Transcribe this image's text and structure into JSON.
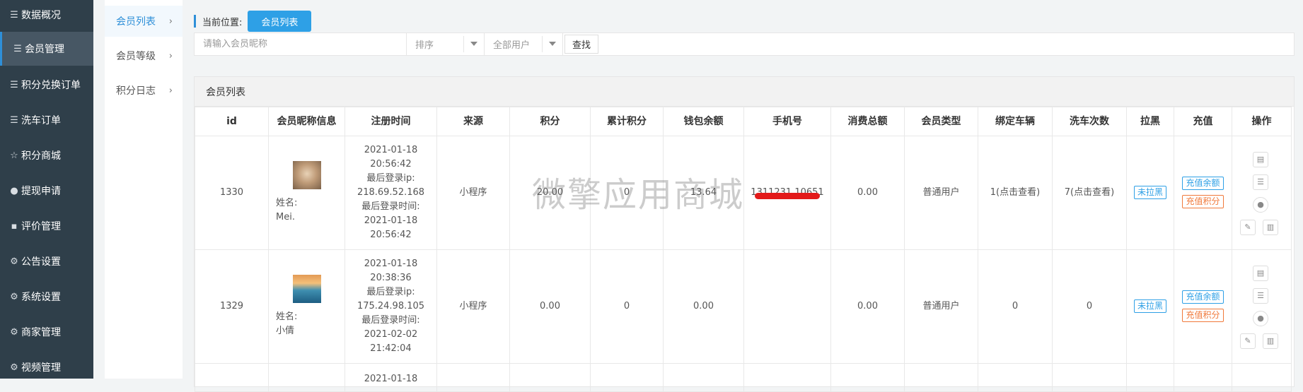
{
  "sidebar": {
    "items": [
      {
        "label": "数据概况",
        "icon": "list-icon"
      },
      {
        "label": "会员管理",
        "icon": "list-icon"
      },
      {
        "label": "积分兑换订单",
        "icon": "list-icon"
      },
      {
        "label": "洗车订单",
        "icon": "list-icon"
      },
      {
        "label": "积分商城",
        "icon": "star-icon"
      },
      {
        "label": "提现申请",
        "icon": "users-icon"
      },
      {
        "label": "评价管理",
        "icon": "comment-icon"
      },
      {
        "label": "公告设置",
        "icon": "gear-icon"
      },
      {
        "label": "系统设置",
        "icon": "gear-icon"
      },
      {
        "label": "商家管理",
        "icon": "gear-icon"
      },
      {
        "label": "视频管理",
        "icon": "gear-icon"
      }
    ]
  },
  "submenu": {
    "items": [
      {
        "label": "会员列表"
      },
      {
        "label": "会员等级"
      },
      {
        "label": "积分日志"
      }
    ]
  },
  "breadcrumb": {
    "label": "当前位置:",
    "current": "会员列表"
  },
  "filters": {
    "search_placeholder": "请输入会员昵称",
    "sort_label": "排序",
    "user_type_label": "全部用户",
    "search_button": "查找"
  },
  "panel": {
    "title": "会员列表"
  },
  "table": {
    "headers": [
      "id",
      "会员昵称信息",
      "注册时间",
      "来源",
      "积分",
      "累计积分",
      "钱包余额",
      "手机号",
      "消费总额",
      "会员类型",
      "绑定车辆",
      "洗车次数",
      "拉黑",
      "充值",
      "操作"
    ],
    "rows": [
      {
        "id": "1330",
        "name_label": "姓名:",
        "name": "Mei.",
        "reg_time": "2021-01-18 20:56:42",
        "last_ip_label": "最后登录ip:",
        "last_ip": "218.69.52.168",
        "last_login_label": "最后登录时间:",
        "last_login": "2021-01-18 20:56:42",
        "source": "小程序",
        "points": "20.00",
        "total_points": "0",
        "wallet": "13.64",
        "phone": "1311231 10651",
        "spend": "0.00",
        "member_type": "普通用户",
        "cars": "1(点击查看)",
        "washes": "7(点击查看)",
        "blacklist": "未拉黑",
        "recharge_balance": "充值余额",
        "recharge_points": "充值积分"
      },
      {
        "id": "1329",
        "name_label": "姓名:",
        "name": "小倩",
        "reg_time": "2021-01-18 20:38:36",
        "last_ip_label": "最后登录ip:",
        "last_ip": "175.24.98.105",
        "last_login_label": "最后登录时间:",
        "last_login": "2021-02-02 21:42:04",
        "source": "小程序",
        "points": "0.00",
        "total_points": "0",
        "wallet": "0.00",
        "phone": "",
        "spend": "0.00",
        "member_type": "普通用户",
        "cars": "0",
        "washes": "0",
        "blacklist": "未拉黑",
        "recharge_balance": "充值余额",
        "recharge_points": "充值积分"
      },
      {
        "reg_date": "2021-01-18"
      }
    ]
  },
  "watermark": "微擎应用商城",
  "colors": {
    "accent": "#2ea0e6",
    "sidebar_bg": "#2f3f4a",
    "orange": "#f0793a",
    "redact": "#e31a1a"
  }
}
